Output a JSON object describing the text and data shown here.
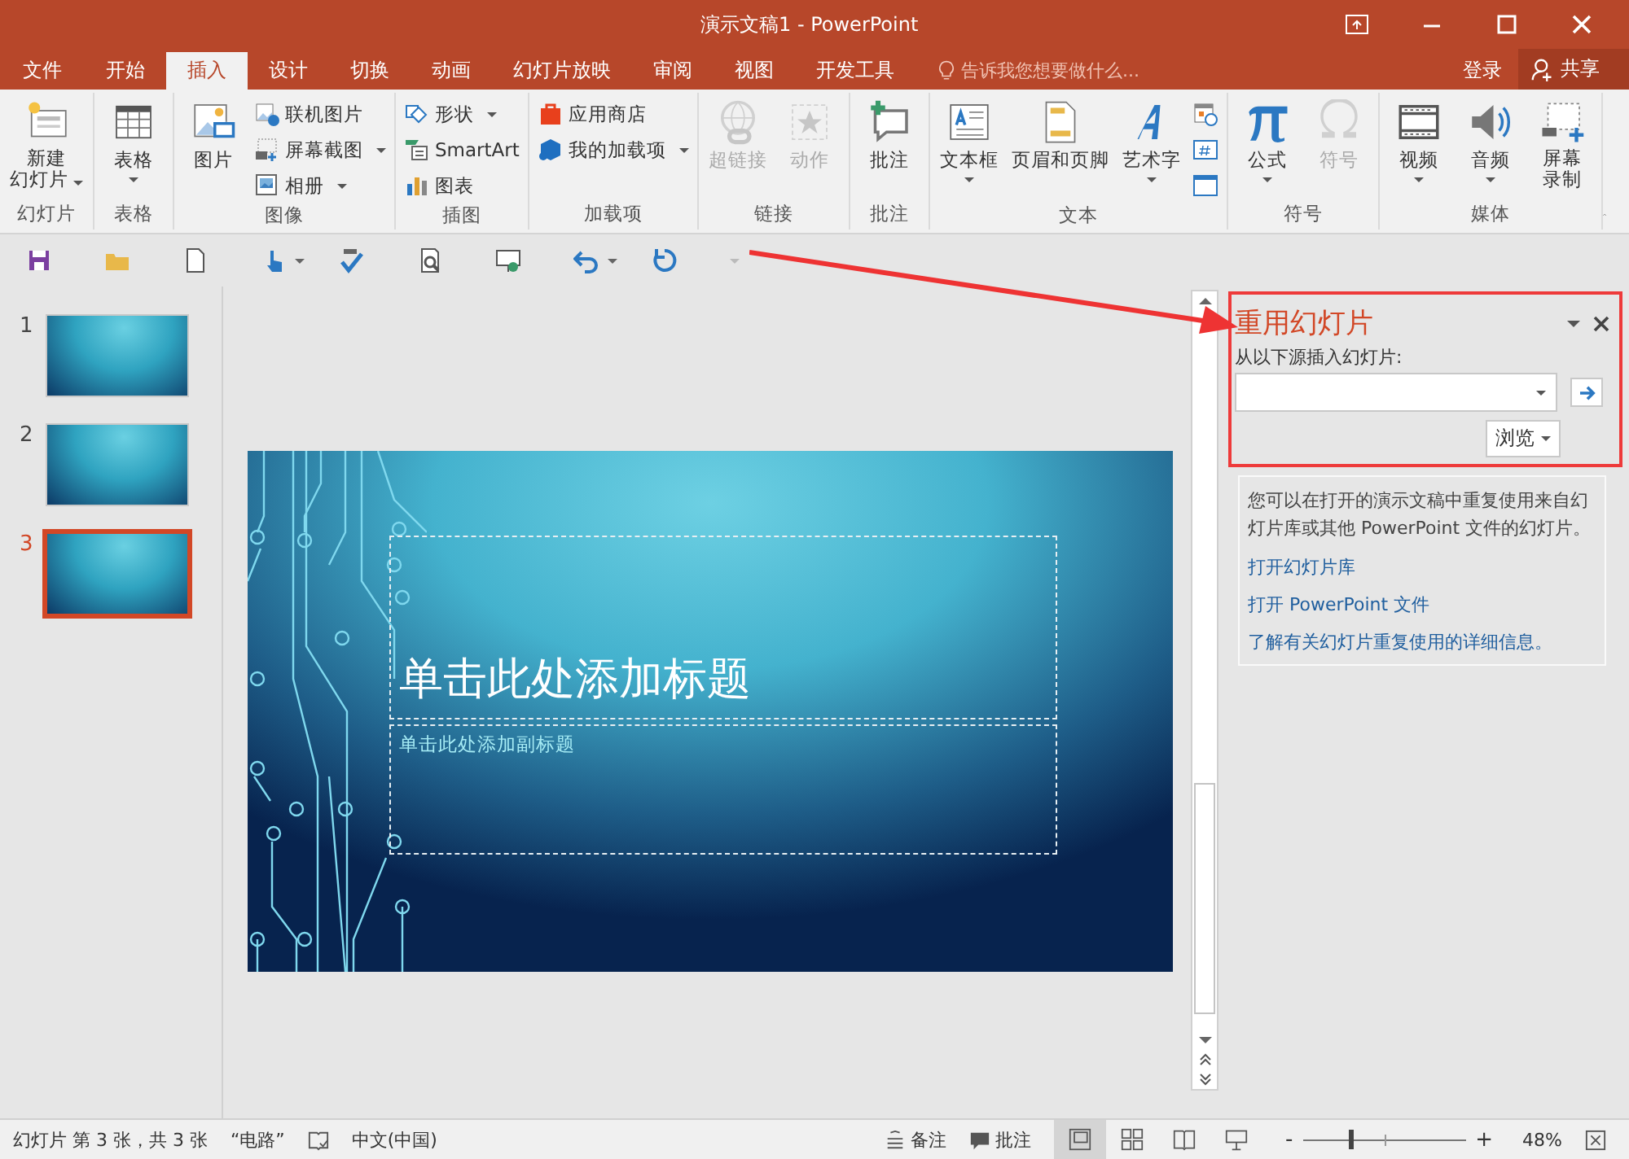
{
  "window": {
    "title": "演示文稿1 - PowerPoint"
  },
  "tabs": [
    {
      "label": "文件",
      "selected": false
    },
    {
      "label": "开始",
      "selected": false
    },
    {
      "label": "插入",
      "selected": true
    },
    {
      "label": "设计",
      "selected": false
    },
    {
      "label": "切换",
      "selected": false
    },
    {
      "label": "动画",
      "selected": false
    },
    {
      "label": "幻灯片放映",
      "selected": false
    },
    {
      "label": "审阅",
      "selected": false
    },
    {
      "label": "视图",
      "selected": false
    },
    {
      "label": "开发工具",
      "selected": false
    }
  ],
  "tell_me": {
    "placeholder": "告诉我您想要做什么..."
  },
  "account": {
    "sign_in": "登录",
    "share": "共享"
  },
  "ribbon": {
    "groups": [
      {
        "name": "幻灯片",
        "columns": [
          {
            "kind": "large",
            "lines": [
              "新建",
              "幻灯片"
            ],
            "dropdown": true,
            "disabled": false
          }
        ]
      },
      {
        "name": "表格",
        "columns": [
          {
            "kind": "large",
            "label": "表格",
            "dropdown": true,
            "disabled": false
          }
        ]
      },
      {
        "name": "图像",
        "columns": [
          {
            "kind": "large",
            "label": "图片",
            "dropdown": false,
            "disabled": false
          },
          {
            "kind": "stack",
            "buttons": [
              {
                "label": "联机图片",
                "dropdown": false,
                "disabled": false
              },
              {
                "label": "屏幕截图",
                "dropdown": true,
                "disabled": false
              },
              {
                "label": "相册",
                "dropdown": true,
                "disabled": false
              }
            ]
          }
        ]
      },
      {
        "name": "插图",
        "columns": [
          {
            "kind": "stack",
            "buttons": [
              {
                "label": "形状",
                "dropdown": true,
                "disabled": false
              },
              {
                "label": "SmartArt",
                "dropdown": false,
                "disabled": false
              },
              {
                "label": "图表",
                "dropdown": false,
                "disabled": false
              }
            ]
          }
        ]
      },
      {
        "name": "加载项",
        "columns": [
          {
            "kind": "stack",
            "buttons": [
              {
                "label": "应用商店",
                "dropdown": false,
                "disabled": false
              },
              {
                "label": "我的加载项",
                "dropdown": true,
                "disabled": false
              }
            ]
          }
        ]
      },
      {
        "name": "链接",
        "columns": [
          {
            "kind": "large",
            "label": "超链接",
            "dropdown": false,
            "disabled": true
          },
          {
            "kind": "large",
            "label": "动作",
            "dropdown": false,
            "disabled": true
          }
        ]
      },
      {
        "name": "批注",
        "columns": [
          {
            "kind": "large",
            "label": "批注",
            "dropdown": false,
            "disabled": false
          }
        ]
      },
      {
        "name": "文本",
        "columns": [
          {
            "kind": "large",
            "label": "文本框",
            "dropdown": true,
            "disabled": false
          },
          {
            "kind": "large",
            "label": "页眉和页脚",
            "dropdown": false,
            "disabled": false
          },
          {
            "kind": "large",
            "label": "艺术字",
            "dropdown": true,
            "disabled": false
          },
          {
            "kind": "stack",
            "buttons": [
              {
                "dropdown": false,
                "disabled": false
              },
              {
                "dropdown": false,
                "disabled": false
              },
              {
                "dropdown": false,
                "disabled": false
              }
            ]
          }
        ]
      },
      {
        "name": "符号",
        "columns": [
          {
            "kind": "large",
            "label": "公式",
            "dropdown": true,
            "disabled": false
          },
          {
            "kind": "large",
            "label": "符号",
            "dropdown": false,
            "disabled": true
          }
        ]
      },
      {
        "name": "媒体",
        "columns": [
          {
            "kind": "large",
            "label": "视频",
            "dropdown": true,
            "disabled": false
          },
          {
            "kind": "large",
            "label": "音频",
            "dropdown": true,
            "disabled": false
          },
          {
            "kind": "large",
            "lines": [
              "屏幕",
              "录制"
            ],
            "dropdown": false,
            "disabled": false
          }
        ]
      }
    ]
  },
  "thumbnails": [
    {
      "number": "1",
      "selected": false
    },
    {
      "number": "2",
      "selected": false
    },
    {
      "number": "3",
      "selected": true
    }
  ],
  "slide": {
    "title": "单击此处添加标题",
    "subtitle": "单击此处添加副标题"
  },
  "task_pane": {
    "title": "重用幻灯片",
    "source_label": "从以下源插入幻灯片:",
    "browse": "浏览",
    "description": "您可以在打开的演示文稿中重复使用来自幻灯片库或其他 PowerPoint 文件的幻灯片。",
    "links": [
      "打开幻灯片库",
      "打开 PowerPoint 文件",
      "了解有关幻灯片重复使用的详细信息。"
    ]
  },
  "status_bar": {
    "slide_info": "幻灯片 第 3 张，共 3 张",
    "theme": "“电路”",
    "language": "中文(中国)",
    "notes": "备注",
    "comments": "批注",
    "views": [
      {
        "selected": true
      },
      {
        "selected": false
      },
      {
        "selected": false
      },
      {
        "selected": false
      }
    ],
    "zoom_out": "-",
    "zoom_in": "+",
    "zoom": {
      "level": 0.28
    },
    "zoom_percent": "48%"
  }
}
